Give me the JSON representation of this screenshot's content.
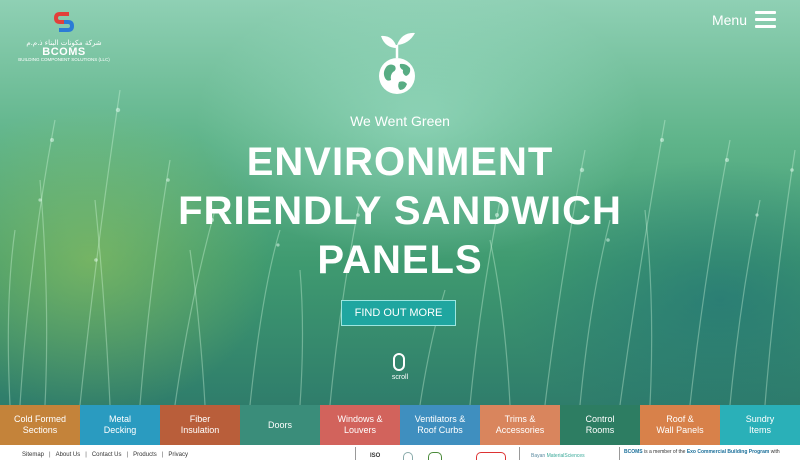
{
  "brand": {
    "arabic_name": "شركة مكونات البناء ذ.م.م",
    "name": "BCOMS",
    "subtitle": "BUILDING COMPONENT SOLUTIONS (LLC)",
    "colors": {
      "red": "#e2403a",
      "blue": "#2b7bd6"
    }
  },
  "header": {
    "menu_label": "Menu",
    "menu_icon": "hamburger-icon"
  },
  "hero": {
    "icon": "eco-globe-sprout-icon",
    "tagline": "We Went Green",
    "headline_lines": [
      "ENVIRONMENT",
      "FRIENDLY SANDWICH",
      "PANELS"
    ],
    "cta_label": "FIND OUT MORE",
    "scroll_label": "scroll",
    "accent_color": "#1fa6a0"
  },
  "product_tiles": [
    {
      "line1": "Cold Formed",
      "line2": "Sections",
      "color": "#c4833a"
    },
    {
      "line1": "Metal",
      "line2": "Decking",
      "color": "#2a9bc0"
    },
    {
      "line1": "Fiber",
      "line2": "Insulation",
      "color": "#b95e3a"
    },
    {
      "line1": "Doors",
      "line2": "",
      "color": "#3a8d7a"
    },
    {
      "line1": "Windows &",
      "line2": "Louvers",
      "color": "#d2635c"
    },
    {
      "line1": "Ventilators &",
      "line2": "Roof Curbs",
      "color": "#3f8fbf"
    },
    {
      "line1": "Trims &",
      "line2": "Accessories",
      "color": "#d9855d"
    },
    {
      "line1": "Control",
      "line2": "Rooms",
      "color": "#2d7d62"
    },
    {
      "line1": "Roof &",
      "line2": "Wall Panels",
      "color": "#d8814a"
    },
    {
      "line1": "Sundry",
      "line2": "Items",
      "color": "#2ab0b8"
    }
  ],
  "footer": {
    "links": [
      "Sitemap",
      "About Us",
      "Contact Us",
      "Products",
      "Privacy"
    ],
    "certifications": [
      "ISO"
    ],
    "partner_name_1": "Bayan",
    "partner_name_2": "MaterialSciences",
    "member_brand": "BCOMS",
    "member_text": " is a member of the ",
    "member_program": "Exo Commercial Building Program",
    "member_suffix": " with"
  }
}
